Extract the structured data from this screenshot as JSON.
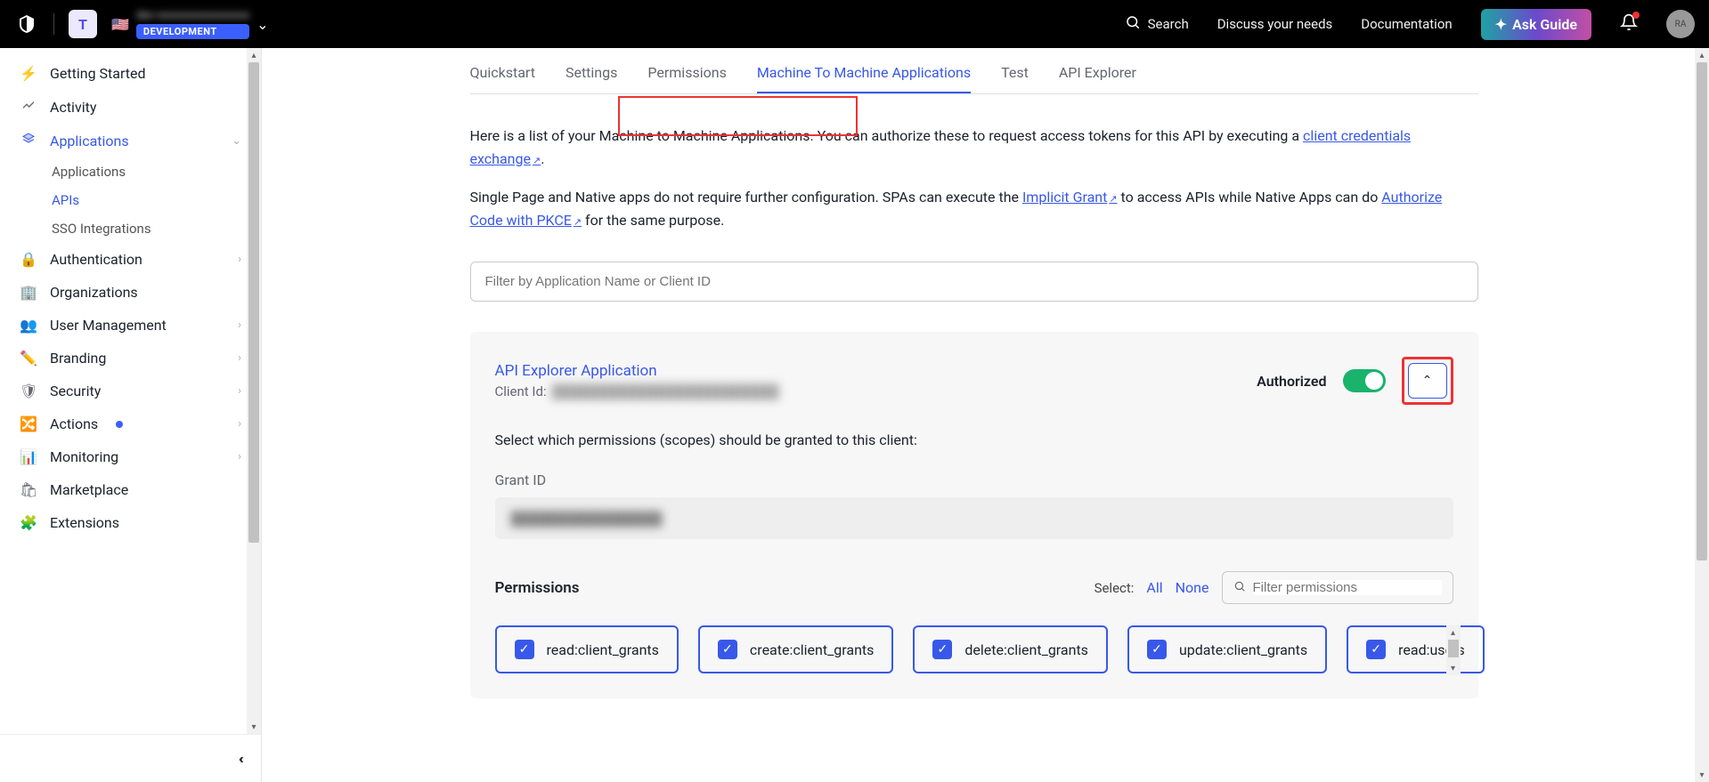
{
  "topbar": {
    "tenant_letter": "T",
    "tenant_name": "dev-xxxxxxxxxxxxxxxx",
    "env_badge": "DEVELOPMENT",
    "search_label": "Search",
    "discuss_label": "Discuss your needs",
    "docs_label": "Documentation",
    "ask_label": "Ask Guide",
    "avatar_initials": "RA"
  },
  "sidebar": {
    "items": [
      {
        "icon": "⚡",
        "label": "Getting Started",
        "expandable": false
      },
      {
        "icon": "📈",
        "label": "Activity",
        "expandable": false
      },
      {
        "icon": "📚",
        "label": "Applications",
        "expandable": true,
        "active": true
      },
      {
        "icon": "🔒",
        "label": "Authentication",
        "expandable": true
      },
      {
        "icon": "🏢",
        "label": "Organizations",
        "expandable": false
      },
      {
        "icon": "👥",
        "label": "User Management",
        "expandable": true
      },
      {
        "icon": "✏️",
        "label": "Branding",
        "expandable": true
      },
      {
        "icon": "🛡",
        "label": "Security",
        "expandable": true
      },
      {
        "icon": "🔀",
        "label": "Actions",
        "expandable": true,
        "dot": true
      },
      {
        "icon": "📊",
        "label": "Monitoring",
        "expandable": true
      },
      {
        "icon": "🛍",
        "label": "Marketplace",
        "expandable": false
      },
      {
        "icon": "🧩",
        "label": "Extensions",
        "expandable": false
      }
    ],
    "sub_apps": {
      "applications": "Applications",
      "apis": "APIs",
      "sso": "SSO Integrations"
    }
  },
  "tabs": {
    "quickstart": "Quickstart",
    "settings": "Settings",
    "permissions": "Permissions",
    "m2m": "Machine To Machine Applications",
    "test": "Test",
    "explorer": "API Explorer"
  },
  "intro": {
    "p1a": "Here is a list of your Machine to Machine Applications. You can authorize these to request access tokens for this API by executing a ",
    "p1_link": "client credentials exchange",
    "p1b": ".",
    "p2a": "Single Page and Native apps do not require further configuration. SPAs can execute the ",
    "p2_link1": "Implicit Grant",
    "p2b": " to access APIs while Native Apps can do ",
    "p2_link2": "Authorize Code with PKCE",
    "p2c": " for the same purpose."
  },
  "filter_placeholder": "Filter by Application Name or Client ID",
  "app_panel": {
    "title": "API Explorer Application",
    "client_id_label": "Client Id:",
    "client_id_value": "████████████████████████",
    "authorized_label": "Authorized",
    "scope_text": "Select which permissions (scopes) should be granted to this client:",
    "grant_label": "Grant ID",
    "grant_value": "████████████████"
  },
  "perm_section": {
    "title": "Permissions",
    "select_label": "Select:",
    "all": "All",
    "none": "None",
    "filter_placeholder": "Filter permissions",
    "scopes": [
      "read:client_grants",
      "create:client_grants",
      "delete:client_grants",
      "update:client_grants",
      "read:users"
    ]
  }
}
